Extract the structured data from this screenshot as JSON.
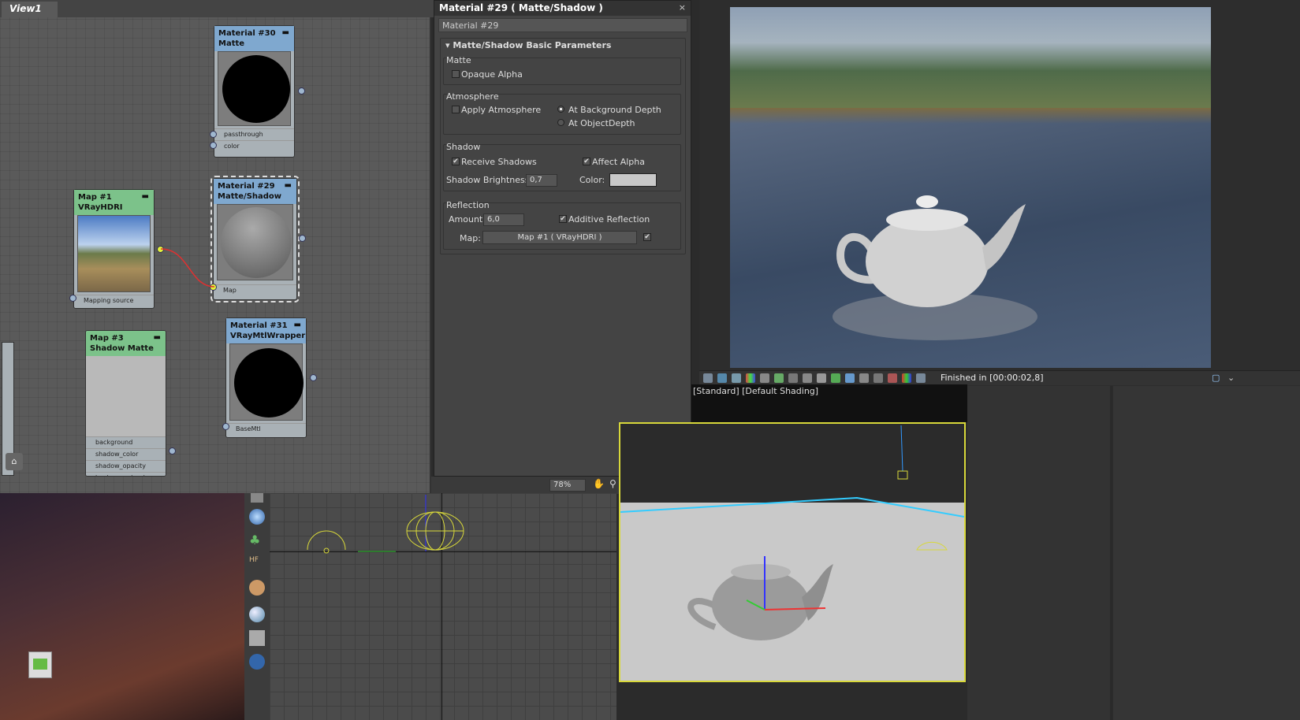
{
  "node_editor": {
    "view_tab": "View1",
    "nodes": {
      "mat30": {
        "title": "Material #30",
        "type": "Matte",
        "slots": [
          "passthrough",
          "color"
        ]
      },
      "mat29": {
        "title": "Material #29",
        "type": "Matte/Shadow",
        "slots": [
          "Map"
        ]
      },
      "map1": {
        "title": "Map #1",
        "type": "VRayHDRI",
        "slots": [
          "Mapping source"
        ]
      },
      "map3": {
        "title": "Map #3",
        "type": "Shadow Matte",
        "slots": [
          "background",
          "shadow_color",
          "shadow_opacity",
          "background_color"
        ]
      },
      "mat31": {
        "title": "Material #31",
        "type": "VRayMtlWrapper",
        "slots": [
          "BaseMtl"
        ]
      }
    },
    "zoom": "78%"
  },
  "material_panel": {
    "title": "Material #29  ( Matte/Shadow )",
    "name": "Material #29",
    "rollout_title": "Matte/Shadow Basic Parameters",
    "matte": {
      "label": "Matte",
      "opaque_alpha": "Opaque Alpha",
      "opaque_alpha_checked": false
    },
    "atmosphere": {
      "label": "Atmosphere",
      "apply": "Apply Atmosphere",
      "bg_depth": "At Background Depth",
      "obj_depth": "At ObjectDepth"
    },
    "shadow": {
      "label": "Shadow",
      "receive": "Receive Shadows",
      "affect_alpha": "Affect Alpha",
      "brightness_label": "Shadow Brightness:",
      "brightness": "0,7",
      "color_label": "Color:",
      "color": "#c8c8c8"
    },
    "reflection": {
      "label": "Reflection",
      "amount_label": "Amount:",
      "amount": "6,0",
      "additive": "Additive Reflection",
      "map_label": "Map:",
      "map_value": "Map #1  ( VRayHDRI )"
    }
  },
  "render_window": {
    "status": "Finished in [00:00:02,8]"
  },
  "viewport": {
    "label": "[Standard] [Default Shading]"
  },
  "colors": {
    "accent": "#d8d83a",
    "wire": "#e03030"
  }
}
